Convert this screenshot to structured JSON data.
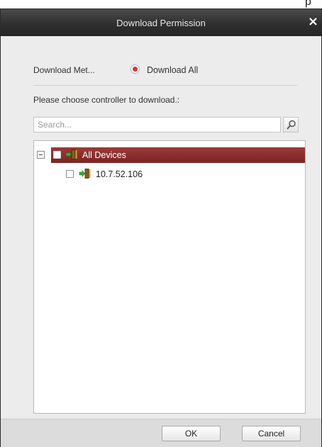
{
  "page_fragment": "p",
  "dialog": {
    "title": "Download Permission",
    "close_glyph": "×",
    "method_label": "Download Met...",
    "method_option": "Download All",
    "method_selected": true,
    "prompt": "Please choose controller to download.:",
    "search": {
      "placeholder": "Search..."
    },
    "tree": {
      "root": {
        "label": "All Devices",
        "checked": false,
        "expanded": true
      },
      "devices": [
        {
          "label": "10.7.52.106",
          "checked": false
        }
      ]
    },
    "buttons": {
      "ok": "OK",
      "cancel": "Cancel"
    }
  },
  "colors": {
    "titlebar": "#2f2f2f",
    "selection": "#8a2c2c",
    "radio_dot": "#e03030",
    "dialog_bg": "#ececec"
  },
  "icons": [
    "close-icon",
    "radio-icon",
    "search-icon",
    "collapse-icon",
    "device-icon"
  ]
}
